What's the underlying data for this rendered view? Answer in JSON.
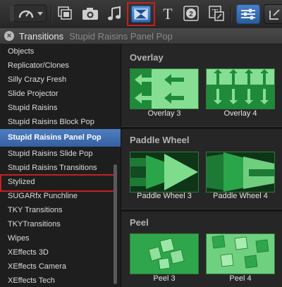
{
  "toolbar": {
    "icons": [
      "dashboard-icon",
      "chevron-down-icon",
      "browser-icon",
      "camera-icon",
      "music-icon",
      "transitions-icon",
      "title-icon",
      "generator-icon",
      "theme-icon",
      "inspector-icon",
      "share-icon"
    ],
    "accent": "#3f78c4",
    "highlight_color": "#c42020"
  },
  "header": {
    "title": "Transitions",
    "subtitle": "Stupid Raisins Panel Pop"
  },
  "sidebar": {
    "items": [
      {
        "label": "Objects"
      },
      {
        "label": "Replicator/Clones"
      },
      {
        "label": "Silly Crazy Fresh"
      },
      {
        "label": "Slide Projector"
      },
      {
        "label": "Stupid Raisins"
      },
      {
        "label": "Stupid Raisins Block Pop"
      },
      {
        "label": "Stupid Raisins Panel Pop"
      },
      {
        "label": "Stupid Raisins Slide Pop"
      },
      {
        "label": "Stupid Raisins Transitions"
      },
      {
        "label": "Stylized"
      },
      {
        "label": "SUGARfx Punchline"
      },
      {
        "label": "TKY Transitions"
      },
      {
        "label": "TKYTransitions"
      },
      {
        "label": "Wipes"
      },
      {
        "label": "XEffects 3D"
      },
      {
        "label": "XEffects Camera"
      },
      {
        "label": "XEffects Tech"
      }
    ],
    "selected_index": 6
  },
  "content": {
    "sections": [
      {
        "title": "Overlay",
        "items": [
          {
            "label": "Overlay 3"
          },
          {
            "label": "Overlay 4"
          }
        ]
      },
      {
        "title": "Paddle Wheel",
        "items": [
          {
            "label": "Paddle Wheel 3"
          },
          {
            "label": "Paddle Wheel 4"
          }
        ]
      },
      {
        "title": "Peel",
        "items": [
          {
            "label": "Peel 3"
          },
          {
            "label": "Peel 4"
          }
        ]
      }
    ],
    "thumb_color_light": "#74d383",
    "thumb_color_dark": "#1e8a3a"
  }
}
